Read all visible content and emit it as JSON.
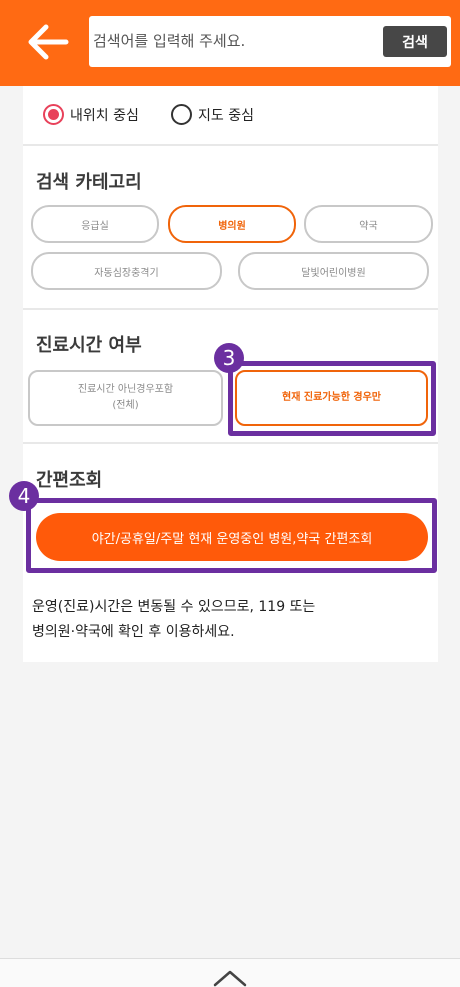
{
  "search": {
    "placeholder": "검색어를 입력해 주세요.",
    "button_label": "검색"
  },
  "location_filter": {
    "options": [
      {
        "label": "내위치 중심",
        "selected": true
      },
      {
        "label": "지도 중심",
        "selected": false
      }
    ]
  },
  "category": {
    "title": "검색 카테고리",
    "items": [
      {
        "label": "응급실",
        "active": false
      },
      {
        "label": "병의원",
        "active": true
      },
      {
        "label": "약국",
        "active": false
      },
      {
        "label": "자동심장충격기",
        "active": false
      },
      {
        "label": "달빛어린이병원",
        "active": false
      }
    ]
  },
  "hours": {
    "title": "진료시간 여부",
    "option_all_line1": "진료시간 아닌경우포함",
    "option_all_line2": "(전체)",
    "option_now": "현재 진료가능한 경우만",
    "badge": "3"
  },
  "quick": {
    "title": "간편조회",
    "button_label": "야간/공휴일/주말 현재 운영중인 병원,약국 간편조회",
    "badge": "4"
  },
  "notice": {
    "line1": "운영(진료)시간은 변동될 수 있으므로, 119 또는",
    "line2": "병의원·약국에 확인 후 이용하세요."
  },
  "colors": {
    "brand_orange": "#ff6a13",
    "highlight_purple": "#6b2fa0",
    "radio_selected": "#e8415a"
  }
}
